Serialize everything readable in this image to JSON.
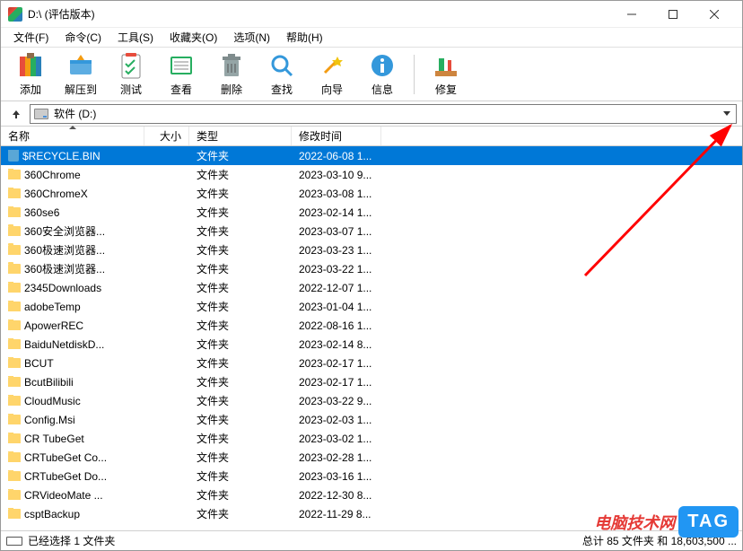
{
  "title": "D:\\ (评估版本)",
  "menus": [
    "文件(F)",
    "命令(C)",
    "工具(S)",
    "收藏夹(O)",
    "选项(N)",
    "帮助(H)"
  ],
  "tools": [
    {
      "label": "添加",
      "icon": "add"
    },
    {
      "label": "解压到",
      "icon": "extract"
    },
    {
      "label": "测试",
      "icon": "test"
    },
    {
      "label": "查看",
      "icon": "view"
    },
    {
      "label": "删除",
      "icon": "delete"
    },
    {
      "label": "查找",
      "icon": "find"
    },
    {
      "label": "向导",
      "icon": "wizard"
    },
    {
      "label": "信息",
      "icon": "info"
    }
  ],
  "tools2": [
    {
      "label": "修复",
      "icon": "repair"
    }
  ],
  "path": "软件 (D:)",
  "columns": {
    "name": "名称",
    "size": "大小",
    "type": "类型",
    "date": "修改时间"
  },
  "files": [
    {
      "name": "$RECYCLE.BIN",
      "type": "文件夹",
      "date": "2022-06-08 1...",
      "icon": "recycle",
      "selected": true
    },
    {
      "name": "360Chrome",
      "type": "文件夹",
      "date": "2023-03-10 9...",
      "icon": "folder"
    },
    {
      "name": "360ChromeX",
      "type": "文件夹",
      "date": "2023-03-08 1...",
      "icon": "folder"
    },
    {
      "name": "360se6",
      "type": "文件夹",
      "date": "2023-02-14 1...",
      "icon": "folder"
    },
    {
      "name": "360安全浏览器...",
      "type": "文件夹",
      "date": "2023-03-07 1...",
      "icon": "folder"
    },
    {
      "name": "360极速浏览器...",
      "type": "文件夹",
      "date": "2023-03-23 1...",
      "icon": "folder"
    },
    {
      "name": "360极速浏览器...",
      "type": "文件夹",
      "date": "2023-03-22 1...",
      "icon": "folder"
    },
    {
      "name": "2345Downloads",
      "type": "文件夹",
      "date": "2022-12-07 1...",
      "icon": "folder"
    },
    {
      "name": "adobeTemp",
      "type": "文件夹",
      "date": "2023-01-04 1...",
      "icon": "folder"
    },
    {
      "name": "ApowerREC",
      "type": "文件夹",
      "date": "2022-08-16 1...",
      "icon": "folder"
    },
    {
      "name": "BaiduNetdiskD...",
      "type": "文件夹",
      "date": "2023-02-14 8...",
      "icon": "folder"
    },
    {
      "name": "BCUT",
      "type": "文件夹",
      "date": "2023-02-17 1...",
      "icon": "folder"
    },
    {
      "name": "BcutBilibili",
      "type": "文件夹",
      "date": "2023-02-17 1...",
      "icon": "folder"
    },
    {
      "name": "CloudMusic",
      "type": "文件夹",
      "date": "2023-03-22 9...",
      "icon": "folder"
    },
    {
      "name": "Config.Msi",
      "type": "文件夹",
      "date": "2023-02-03 1...",
      "icon": "folder"
    },
    {
      "name": "CR TubeGet",
      "type": "文件夹",
      "date": "2023-03-02 1...",
      "icon": "folder"
    },
    {
      "name": "CRTubeGet Co...",
      "type": "文件夹",
      "date": "2023-02-28 1...",
      "icon": "folder"
    },
    {
      "name": "CRTubeGet Do...",
      "type": "文件夹",
      "date": "2023-03-16 1...",
      "icon": "folder"
    },
    {
      "name": "CRVideoMate ...",
      "type": "文件夹",
      "date": "2022-12-30 8...",
      "icon": "folder"
    },
    {
      "name": "csptBackup",
      "type": "文件夹",
      "date": "2022-11-29 8...",
      "icon": "folder"
    }
  ],
  "status": {
    "left": "已经选择 1 文件夹",
    "right": "总计 85 文件夹 和 18,603,500 ..."
  },
  "watermark": {
    "text": "电脑技术网",
    "tag": "TAG"
  }
}
